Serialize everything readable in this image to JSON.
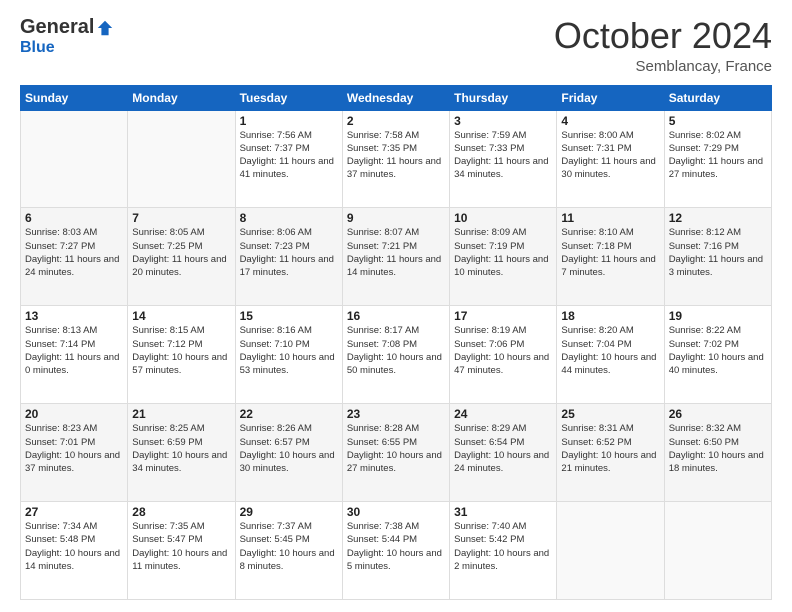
{
  "header": {
    "logo_general": "General",
    "logo_blue": "Blue",
    "month": "October 2024",
    "location": "Semblancay, France"
  },
  "days_of_week": [
    "Sunday",
    "Monday",
    "Tuesday",
    "Wednesday",
    "Thursday",
    "Friday",
    "Saturday"
  ],
  "weeks": [
    [
      {
        "day": "",
        "info": ""
      },
      {
        "day": "",
        "info": ""
      },
      {
        "day": "1",
        "info": "Sunrise: 7:56 AM\nSunset: 7:37 PM\nDaylight: 11 hours and 41 minutes."
      },
      {
        "day": "2",
        "info": "Sunrise: 7:58 AM\nSunset: 7:35 PM\nDaylight: 11 hours and 37 minutes."
      },
      {
        "day": "3",
        "info": "Sunrise: 7:59 AM\nSunset: 7:33 PM\nDaylight: 11 hours and 34 minutes."
      },
      {
        "day": "4",
        "info": "Sunrise: 8:00 AM\nSunset: 7:31 PM\nDaylight: 11 hours and 30 minutes."
      },
      {
        "day": "5",
        "info": "Sunrise: 8:02 AM\nSunset: 7:29 PM\nDaylight: 11 hours and 27 minutes."
      }
    ],
    [
      {
        "day": "6",
        "info": "Sunrise: 8:03 AM\nSunset: 7:27 PM\nDaylight: 11 hours and 24 minutes."
      },
      {
        "day": "7",
        "info": "Sunrise: 8:05 AM\nSunset: 7:25 PM\nDaylight: 11 hours and 20 minutes."
      },
      {
        "day": "8",
        "info": "Sunrise: 8:06 AM\nSunset: 7:23 PM\nDaylight: 11 hours and 17 minutes."
      },
      {
        "day": "9",
        "info": "Sunrise: 8:07 AM\nSunset: 7:21 PM\nDaylight: 11 hours and 14 minutes."
      },
      {
        "day": "10",
        "info": "Sunrise: 8:09 AM\nSunset: 7:19 PM\nDaylight: 11 hours and 10 minutes."
      },
      {
        "day": "11",
        "info": "Sunrise: 8:10 AM\nSunset: 7:18 PM\nDaylight: 11 hours and 7 minutes."
      },
      {
        "day": "12",
        "info": "Sunrise: 8:12 AM\nSunset: 7:16 PM\nDaylight: 11 hours and 3 minutes."
      }
    ],
    [
      {
        "day": "13",
        "info": "Sunrise: 8:13 AM\nSunset: 7:14 PM\nDaylight: 11 hours and 0 minutes."
      },
      {
        "day": "14",
        "info": "Sunrise: 8:15 AM\nSunset: 7:12 PM\nDaylight: 10 hours and 57 minutes."
      },
      {
        "day": "15",
        "info": "Sunrise: 8:16 AM\nSunset: 7:10 PM\nDaylight: 10 hours and 53 minutes."
      },
      {
        "day": "16",
        "info": "Sunrise: 8:17 AM\nSunset: 7:08 PM\nDaylight: 10 hours and 50 minutes."
      },
      {
        "day": "17",
        "info": "Sunrise: 8:19 AM\nSunset: 7:06 PM\nDaylight: 10 hours and 47 minutes."
      },
      {
        "day": "18",
        "info": "Sunrise: 8:20 AM\nSunset: 7:04 PM\nDaylight: 10 hours and 44 minutes."
      },
      {
        "day": "19",
        "info": "Sunrise: 8:22 AM\nSunset: 7:02 PM\nDaylight: 10 hours and 40 minutes."
      }
    ],
    [
      {
        "day": "20",
        "info": "Sunrise: 8:23 AM\nSunset: 7:01 PM\nDaylight: 10 hours and 37 minutes."
      },
      {
        "day": "21",
        "info": "Sunrise: 8:25 AM\nSunset: 6:59 PM\nDaylight: 10 hours and 34 minutes."
      },
      {
        "day": "22",
        "info": "Sunrise: 8:26 AM\nSunset: 6:57 PM\nDaylight: 10 hours and 30 minutes."
      },
      {
        "day": "23",
        "info": "Sunrise: 8:28 AM\nSunset: 6:55 PM\nDaylight: 10 hours and 27 minutes."
      },
      {
        "day": "24",
        "info": "Sunrise: 8:29 AM\nSunset: 6:54 PM\nDaylight: 10 hours and 24 minutes."
      },
      {
        "day": "25",
        "info": "Sunrise: 8:31 AM\nSunset: 6:52 PM\nDaylight: 10 hours and 21 minutes."
      },
      {
        "day": "26",
        "info": "Sunrise: 8:32 AM\nSunset: 6:50 PM\nDaylight: 10 hours and 18 minutes."
      }
    ],
    [
      {
        "day": "27",
        "info": "Sunrise: 7:34 AM\nSunset: 5:48 PM\nDaylight: 10 hours and 14 minutes."
      },
      {
        "day": "28",
        "info": "Sunrise: 7:35 AM\nSunset: 5:47 PM\nDaylight: 10 hours and 11 minutes."
      },
      {
        "day": "29",
        "info": "Sunrise: 7:37 AM\nSunset: 5:45 PM\nDaylight: 10 hours and 8 minutes."
      },
      {
        "day": "30",
        "info": "Sunrise: 7:38 AM\nSunset: 5:44 PM\nDaylight: 10 hours and 5 minutes."
      },
      {
        "day": "31",
        "info": "Sunrise: 7:40 AM\nSunset: 5:42 PM\nDaylight: 10 hours and 2 minutes."
      },
      {
        "day": "",
        "info": ""
      },
      {
        "day": "",
        "info": ""
      }
    ]
  ]
}
